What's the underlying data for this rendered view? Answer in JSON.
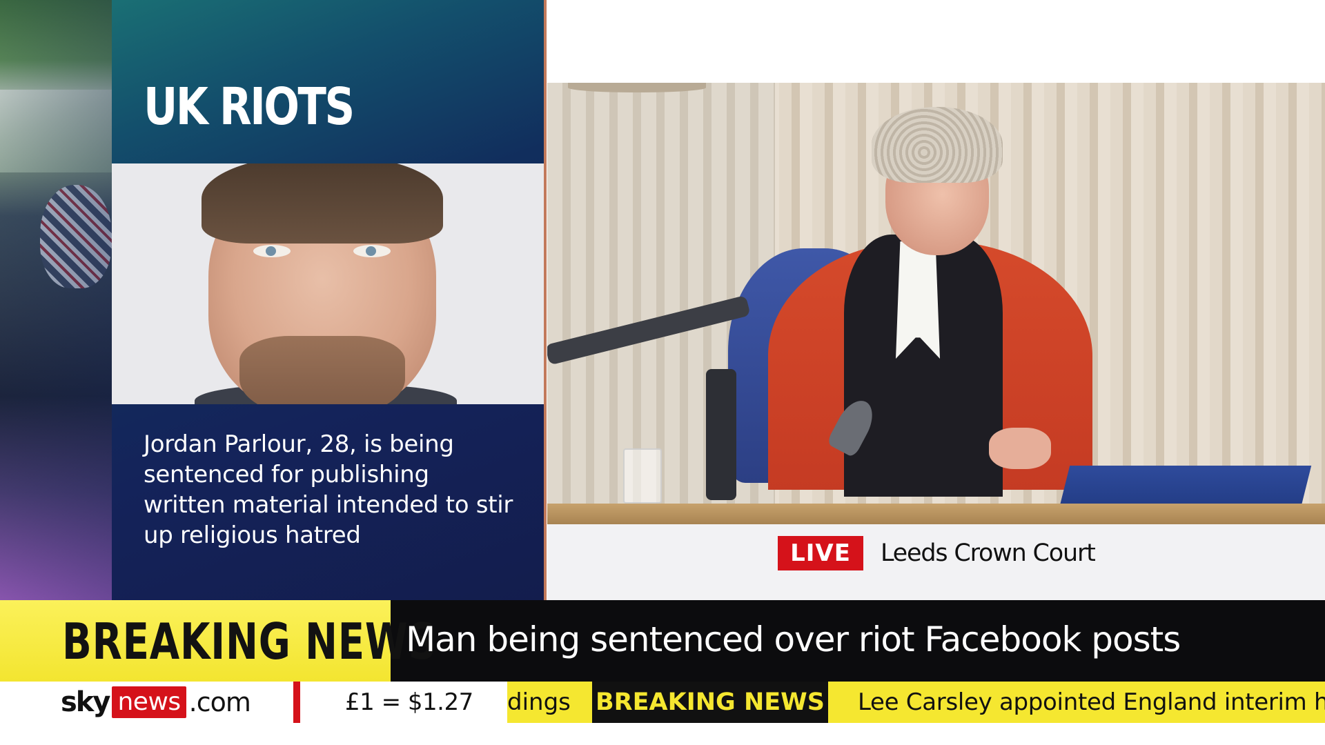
{
  "graphic": {
    "title": "UK RIOTS",
    "caption": "Jordan Parlour, 28, is being sentenced for publishing written material intended to stir up religious hatred"
  },
  "live_feed": {
    "badge": "LIVE",
    "location": "Leeds Crown Court"
  },
  "breaking": {
    "label": "BREAKING NEWS",
    "headline": "Man being sentenced over riot Facebook posts"
  },
  "ticker": {
    "brand_sky": "sky",
    "brand_news": "news",
    "brand_dotcom": ".com",
    "fx": "£1 = $1.27",
    "previous_fragment": "dings",
    "badge": "BREAKING NEWS",
    "text": "Lee Carsley appointed England interim he"
  },
  "colors": {
    "breaking_yellow": "#f3e530",
    "sky_red": "#d5121a",
    "card_navy": "#14235a"
  }
}
